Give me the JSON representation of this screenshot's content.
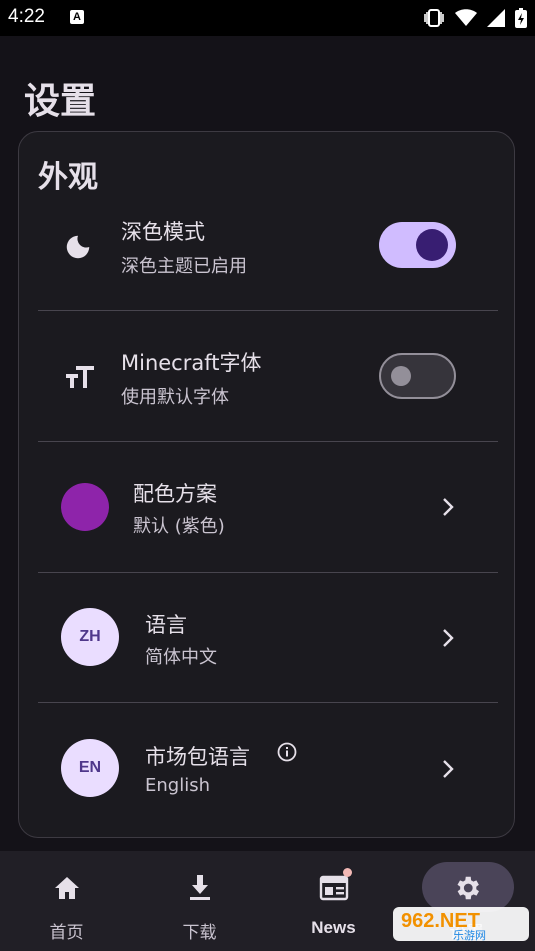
{
  "status": {
    "time": "4:22",
    "a_badge": "A"
  },
  "page": {
    "title": "设置"
  },
  "section": {
    "title": "外观"
  },
  "rows": {
    "dark_mode": {
      "title": "深色模式",
      "subtitle": "深色主题已启用",
      "enabled": true
    },
    "mc_font": {
      "title": "Minecraft字体",
      "subtitle": "使用默认字体",
      "enabled": false
    },
    "color_scheme": {
      "title": "配色方案",
      "subtitle": "默认 (紫色)",
      "color": "#8e24aa"
    },
    "language": {
      "badge": "ZH",
      "title": "语言",
      "subtitle": "简体中文"
    },
    "market_language": {
      "badge": "EN",
      "title": "市场包语言",
      "subtitle": "English"
    }
  },
  "nav": {
    "home": "首页",
    "download": "下载",
    "news": "News",
    "settings": "设置"
  },
  "watermark": {
    "text": "962.NET",
    "sub": "乐游网"
  },
  "colors": {
    "accent": "#d0bcff",
    "accent_dark": "#381e72",
    "background": "#141218"
  }
}
